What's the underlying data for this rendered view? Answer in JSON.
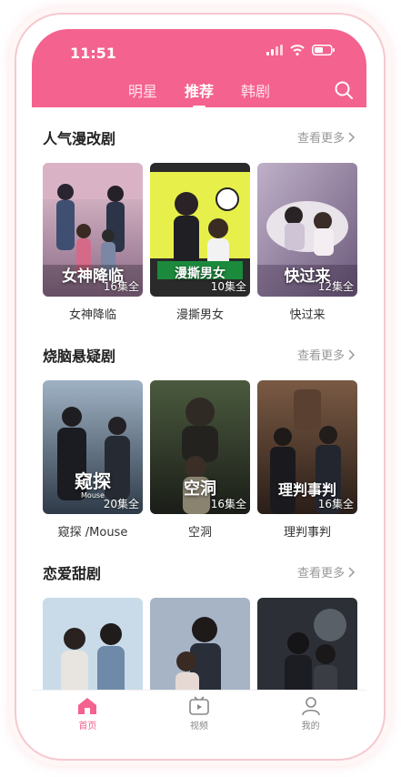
{
  "status": {
    "time": "11:51"
  },
  "top_tabs": [
    {
      "label": "明星"
    },
    {
      "label": "推荐"
    },
    {
      "label": "韩剧"
    }
  ],
  "more_label": "查看更多",
  "sections": [
    {
      "title": "人气漫改剧",
      "items": [
        {
          "name": "女神降临",
          "poster_title": "女神降临",
          "episodes": "16集全"
        },
        {
          "name": "漫撕男女",
          "poster_title": "漫撕男女",
          "episodes": "10集全"
        },
        {
          "name": "快过来",
          "poster_title": "快过来",
          "episodes": "12集全"
        }
      ]
    },
    {
      "title": "烧脑悬疑剧",
      "items": [
        {
          "name": "窥探 /Mouse",
          "poster_title": "窥探",
          "poster_subtitle": "Mouse",
          "episodes": "20集全"
        },
        {
          "name": "空洞",
          "poster_title": "空洞",
          "episodes": "16集全"
        },
        {
          "name": "理判事判",
          "poster_title": "理判事判",
          "episodes": "16集全"
        }
      ]
    },
    {
      "title": "恋爱甜剧",
      "items": [
        {},
        {},
        {}
      ]
    }
  ],
  "tabbar": [
    {
      "label": "首页",
      "icon": "home-icon"
    },
    {
      "label": "视频",
      "icon": "video-icon"
    },
    {
      "label": "我的",
      "icon": "user-icon"
    }
  ],
  "colors": {
    "accent": "#f4628f"
  }
}
